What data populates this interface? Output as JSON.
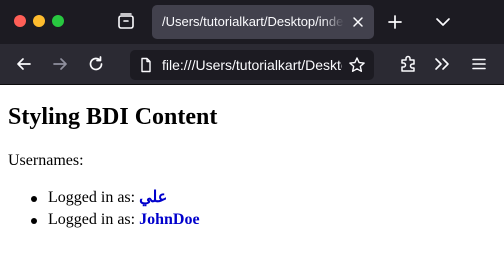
{
  "browser": {
    "tab": {
      "title": "/Users/tutorialkart/Desktop/index.html"
    },
    "urlbar": {
      "url": "file:///Users/tutorialkart/Desktop/index.html"
    }
  },
  "icons": {
    "window_controls": [
      "close-icon",
      "minimize-icon",
      "maximize-icon"
    ],
    "toolbar": [
      "tab-overview-icon",
      "close-tab-icon",
      "new-tab-icon",
      "list-all-tabs-icon",
      "back-icon",
      "forward-icon",
      "reload-icon",
      "file-icon",
      "bookmark-star-icon",
      "extensions-icon",
      "overflow-menu-icon",
      "app-menu-icon"
    ]
  },
  "colors": {
    "titlebar": "#1c1b22",
    "toolbar": "#2b2a33",
    "active_tab": "#42414d",
    "username": "#0000cc",
    "forward_disabled": "#8f8f9d"
  },
  "page": {
    "heading": "Styling BDI Content",
    "intro": "Usernames:",
    "users": [
      {
        "prefix": "Logged in as:",
        "name": "علي"
      },
      {
        "prefix": "Logged in as:",
        "name": "JohnDoe"
      }
    ]
  }
}
